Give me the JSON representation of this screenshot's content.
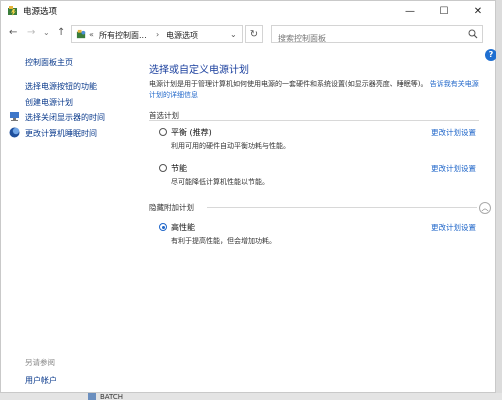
{
  "window": {
    "title": "电源选项",
    "minimize_icon": "—",
    "maximize_icon": "☐",
    "close_icon": "✕"
  },
  "nav": {
    "back": "←",
    "forward": "→",
    "dropdown": "⌄",
    "up": "↑",
    "address_prefix": "«",
    "address_parts": [
      "所有控制面...",
      "电源选项"
    ],
    "address_sep": "›",
    "address_dropdown": "⌄",
    "refresh": "↻",
    "search_placeholder": "搜索控制面板"
  },
  "help": "?",
  "sidebar": {
    "home": "控制面板主页",
    "items": [
      {
        "label": "选择电源按钮的功能"
      },
      {
        "label": "创建电源计划"
      },
      {
        "label": "选择关闭显示器的时间"
      },
      {
        "label": "更改计算机睡眠时间"
      }
    ],
    "see_also": "另请参阅",
    "user_accounts": "用户帐户"
  },
  "main": {
    "heading": "选择或自定义电源计划",
    "description": "电源计划是用于管理计算机如何使用电源的一套硬件和系统设置(如显示器亮度、睡眠等)。",
    "description_link": "告诉我有关电源计划的详细信息",
    "preferred_section": "首选计划",
    "hidden_section": "隐藏附加计划",
    "collapse_icon": "︿",
    "change_label": "更改计划设置",
    "plans": [
      {
        "name": "平衡 (推荐)",
        "desc": "利用可用的硬件自动平衡功耗与性能。",
        "selected": false
      },
      {
        "name": "节能",
        "desc": "尽可能降低计算机性能以节能。",
        "selected": false
      },
      {
        "name": "高性能",
        "desc": "有利于提高性能，但会增加功耗。",
        "selected": true
      }
    ]
  },
  "background": {
    "behind_text": "BATCH"
  }
}
